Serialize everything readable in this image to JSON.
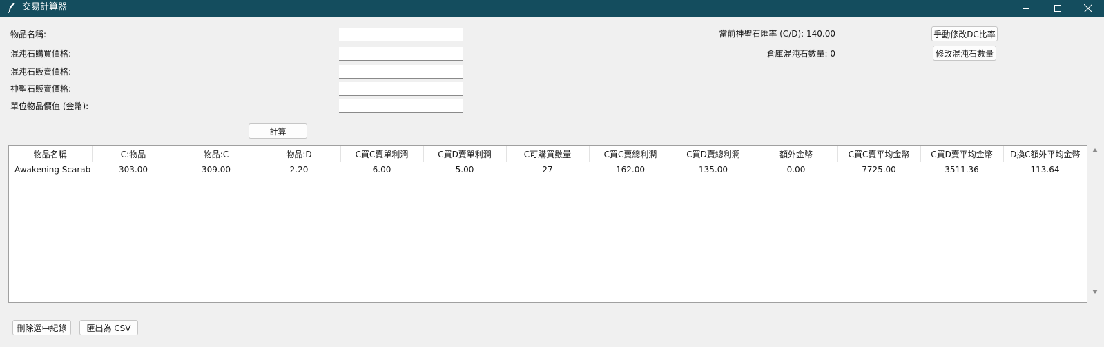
{
  "window": {
    "title": "交易計算器",
    "app_icon": "feather-icon"
  },
  "form": {
    "fields": [
      {
        "label": "物品名稱:",
        "value": ""
      },
      {
        "label": "混沌石購買價格:",
        "value": ""
      },
      {
        "label": "混沌石販賣價格:",
        "value": ""
      },
      {
        "label": "神聖石販賣價格:",
        "value": ""
      },
      {
        "label": "單位物品價值 (金幣):",
        "value": ""
      }
    ],
    "calculate_label": "計算"
  },
  "info": {
    "rate_text": "當前神聖石匯率 (C/D): 140.00",
    "stock_text": "倉庫混沌石數量: 0",
    "edit_rate_label": "手動修改DC比率",
    "edit_stock_label": "修改混沌石數量"
  },
  "table": {
    "columns": [
      "物品名稱",
      "C:物品",
      "物品:C",
      "物品:D",
      "C買C賣單利潤",
      "C買D賣單利潤",
      "C可購買數量",
      "C買C賣總利潤",
      "C買D賣總利潤",
      "額外金幣",
      "C買C賣平均金幣",
      "C買D賣平均金幣",
      "D換C額外平均金幣"
    ],
    "rows": [
      [
        "Awakening Scarab",
        "303.00",
        "309.00",
        "2.20",
        "6.00",
        "5.00",
        "27",
        "162.00",
        "135.00",
        "0.00",
        "7725.00",
        "3511.36",
        "113.64"
      ]
    ]
  },
  "footer": {
    "delete_label": "刪除選中紀錄",
    "export_label": "匯出為 CSV"
  },
  "colors": {
    "titlebar": "#144d5e",
    "background": "#f0f0f0"
  }
}
